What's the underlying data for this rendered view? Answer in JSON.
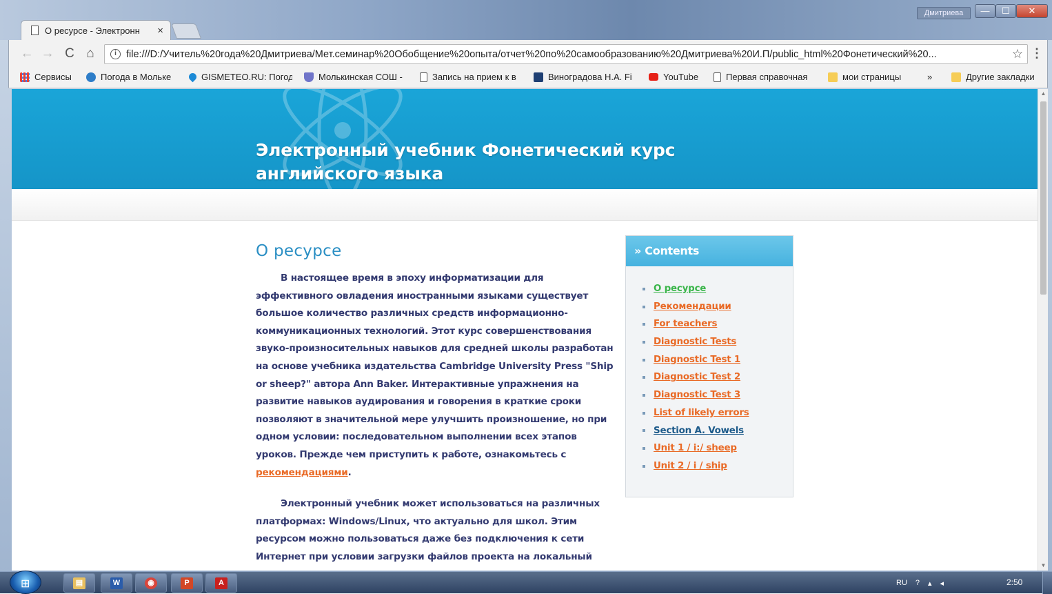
{
  "browser": {
    "tab": {
      "title": "О ресурсе - Электронн",
      "close_label": "×"
    },
    "user_badge": "Дмитриева",
    "window_controls": {
      "minimize": "—",
      "maximize": "☐",
      "close": "✕"
    },
    "nav": {
      "back": "←",
      "forward": "→",
      "reload": "C",
      "home": "⌂"
    },
    "address_bar": {
      "url": "file:///D:/Учитель%20года%20Дмитриева/Мет.семинар%20Обобщение%20опыта/отчет%20по%20самообразованию%20Дмитриева%20И.П/public_html%20Фонетический%20...",
      "info_icon": "i",
      "star_icon": "☆"
    },
    "menu_icon": "⋮",
    "bookmarks": [
      {
        "label": "Сервисы",
        "icon": "apps-grid-icon",
        "color": "#e94235"
      },
      {
        "label": "Погода в Мольке",
        "icon": "weather-icon",
        "color": "#2d7dc8"
      },
      {
        "label": "GISMETEO.RU: Погод",
        "icon": "drop-icon",
        "color": "#1c8ad6"
      },
      {
        "label": "Молькинская СОШ -",
        "icon": "shield-icon",
        "color": "#6f74c9"
      },
      {
        "label": "Запись на прием к в",
        "icon": "page-icon",
        "color": "#ffffff"
      },
      {
        "label": "Виноградова Н.А. Fi",
        "icon": "t-icon",
        "color": "#1e3f73"
      },
      {
        "label": "YouTube",
        "icon": "youtube-icon",
        "color": "#e62117"
      },
      {
        "label": "Первая справочная",
        "icon": "page-icon",
        "color": "#ffffff"
      },
      {
        "label": "мои страницы",
        "icon": "folder-icon",
        "color": "#f6cd56"
      },
      {
        "label": "»",
        "icon": "",
        "color": ""
      },
      {
        "label": "Другие закладки",
        "icon": "folder-icon",
        "color": "#f6cd56"
      }
    ]
  },
  "page": {
    "site_title": "Электронный учебник Фонетический курс английского языка",
    "heading": "О ресурсе",
    "paragraph1": "В настоящее время в эпоху информатизации для эффективного овладения иностранными языками существует большое количество различных средств информационно-коммуникационных технологий. Этот курс совершенствования звуко-произносительных навыков для средней школы разработан на основе учебника издательства Cambridge University Press  \"Ship or sheep?\" автора Ann Baker. Интерактивные упражнения на развитие навыков аудирования и говорения в краткие сроки позволяют в значительной мере улучшить произношение, но при одном условии: последовательном выполнении всех этапов уроков. Прежде чем приступить к работе, ознакомьтесь с ",
    "paragraph1_link": "рекомендациями",
    "paragraph1_end": ".",
    "paragraph2": "Электронный учебник может использоваться на различных платформах: Windows/Linux, что актуально для школ. Этим ресурсом можно пользоваться даже без подключения к сети Интернет при условии загрузки файлов проекта на локальный компьютер.",
    "sidebar": {
      "title": "» Contents",
      "items": [
        {
          "label": "О ресурсе",
          "state": "active"
        },
        {
          "label": "Рекомендации",
          "state": "link"
        },
        {
          "label": "For teachers",
          "state": "link"
        },
        {
          "label": "Diagnostic Tests",
          "state": "link"
        },
        {
          "label": "Diagnostic Test 1",
          "state": "link"
        },
        {
          "label": "Diagnostic Test 2",
          "state": "link"
        },
        {
          "label": "Diagnostic Test 3",
          "state": "link"
        },
        {
          "label": "List of likely errors",
          "state": "link"
        },
        {
          "label": "Section A. Vowels",
          "state": "section"
        },
        {
          "label": "Unit 1 / i:/ sheep",
          "state": "link"
        },
        {
          "label": "Unit 2 / i / ship",
          "state": "link"
        }
      ]
    },
    "colors": {
      "header": "#1aa5d8",
      "heading": "#2b8fc4",
      "body_text": "#333a70",
      "link": "#e96a26",
      "active_link": "#3ab54a"
    }
  },
  "taskbar": {
    "apps": [
      {
        "name": "explorer",
        "glyph": "▤",
        "color": "#e8c060"
      },
      {
        "name": "word",
        "glyph": "W",
        "color": "#2a5caa"
      },
      {
        "name": "chrome",
        "glyph": "◉",
        "color": "#d9453b"
      },
      {
        "name": "powerpoint",
        "glyph": "P",
        "color": "#d24726"
      },
      {
        "name": "acrobat",
        "glyph": "A",
        "color": "#c8201e"
      }
    ],
    "language": "RU",
    "clock": "2:50"
  }
}
